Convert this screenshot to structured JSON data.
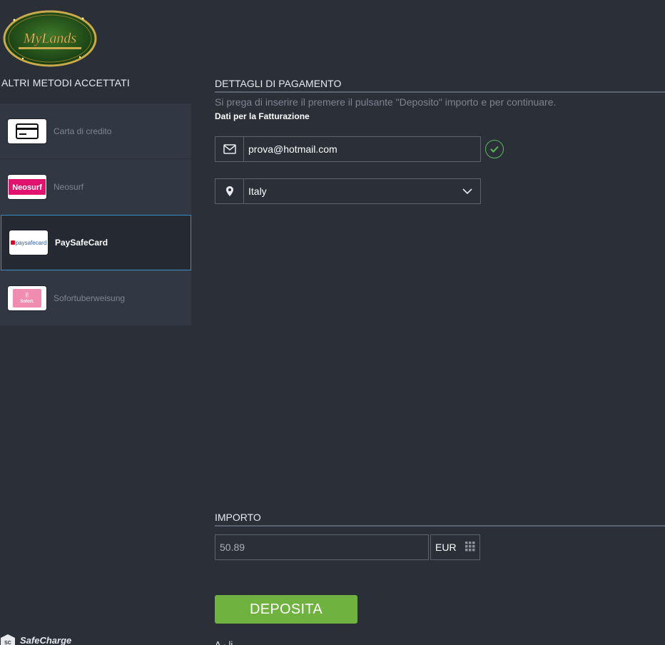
{
  "logo": {
    "text": "MyLands"
  },
  "left": {
    "title": "ALTRI METODI ACCETTATI",
    "methods": [
      {
        "label": "Carta di credito"
      },
      {
        "label": "Neosurf",
        "badge": "Neosurf"
      },
      {
        "label": "PaySafeCard",
        "badge": "paysafecard",
        "active": true
      },
      {
        "label": "Sofortuberweisung",
        "badge": "Sofort."
      }
    ]
  },
  "payment": {
    "title": "DETTAGLI DI PAGAMENTO",
    "hint": "Si prega di inserire il premere il pulsante \"Deposito\" importo e per continuare.",
    "billing_label": "Dati per la Fatturazione",
    "email": "prova@hotmail.com",
    "country": "Italy"
  },
  "amount": {
    "title": "IMPORTO",
    "value": "50.89",
    "currency": "EUR"
  },
  "deposit_label": "DEPOSITA",
  "footer": {
    "brand": "SafeCharge",
    "mark": "SC",
    "cut_text": "A · li"
  },
  "colors": {
    "accent": "#6fb23f",
    "active_border": "#3f8fc9",
    "check": "#5cb85c"
  }
}
